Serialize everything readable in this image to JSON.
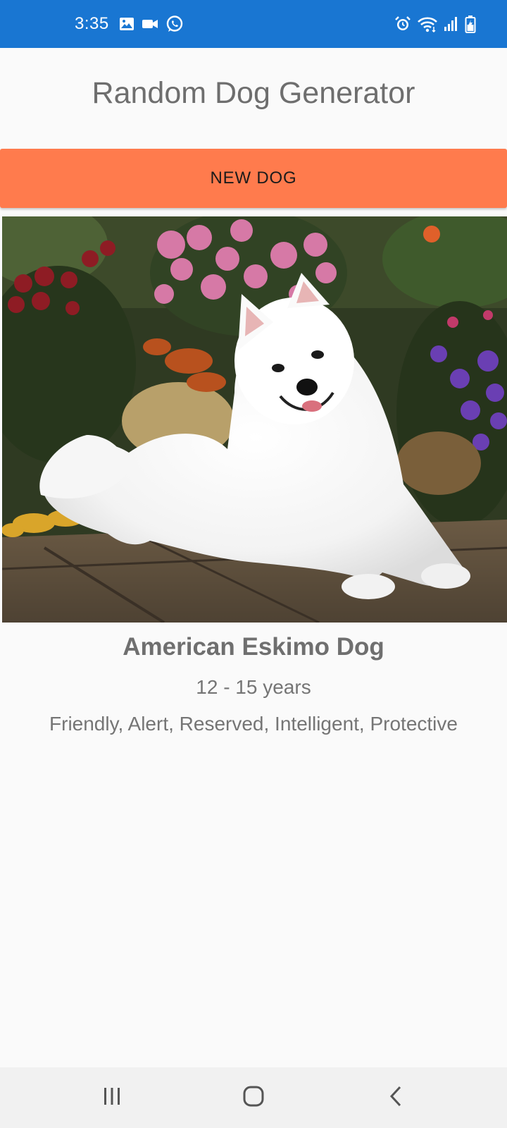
{
  "status_bar": {
    "time": "3:35",
    "left_icons": [
      "image-icon",
      "video-camera-icon",
      "whatsapp-icon"
    ],
    "right_icons": [
      "alarm-icon",
      "wifi-icon",
      "signal-icon",
      "battery-icon"
    ],
    "color": "#1976d2"
  },
  "app": {
    "title": "Random Dog Generator",
    "button_label": "NEW DOG",
    "button_color": "#ff7b4d"
  },
  "dog": {
    "image_icon": "dog-photo",
    "breed": "American Eskimo Dog",
    "life_span": "12 - 15 years",
    "temperament": "Friendly, Alert, Reserved, Intelligent, Protective"
  },
  "nav_bar": {
    "buttons": [
      "recent-apps-icon",
      "home-icon",
      "back-icon"
    ]
  }
}
